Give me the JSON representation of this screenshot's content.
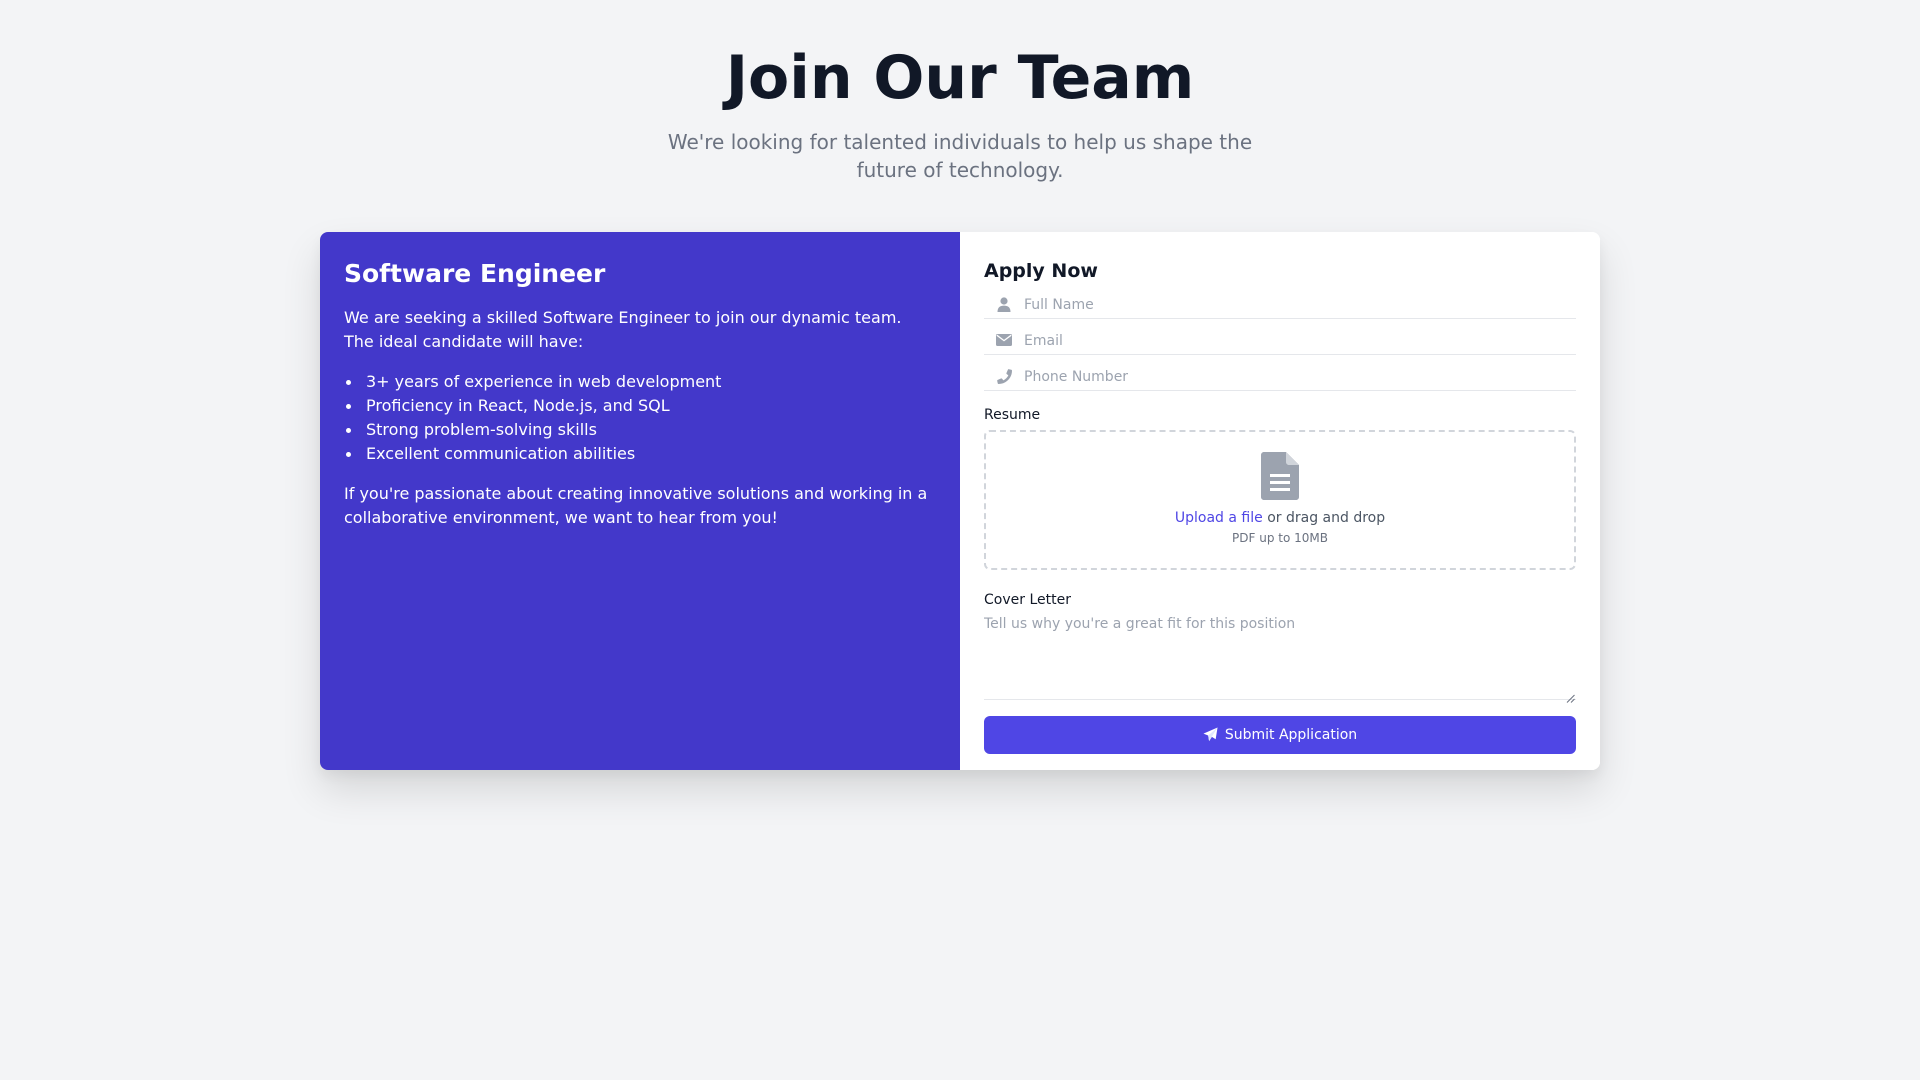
{
  "hero": {
    "title": "Join Our Team",
    "subtitle": "We're looking for talented individuals to help us shape the future of technology."
  },
  "job": {
    "title": "Software Engineer",
    "intro": "We are seeking a skilled Software Engineer to join our dynamic team. The ideal candidate will have:",
    "requirements": [
      "3+ years of experience in web development",
      "Proficiency in React, Node.js, and SQL",
      "Strong problem-solving skills",
      "Excellent communication abilities"
    ],
    "outro": "If you're passionate about creating innovative solutions and working in a collaborative environment, we want to hear from you!"
  },
  "form": {
    "title": "Apply Now",
    "full_name": {
      "icon": "user-icon",
      "placeholder": "Full Name",
      "value": ""
    },
    "email": {
      "icon": "envelope-icon",
      "placeholder": "Email",
      "value": ""
    },
    "phone": {
      "icon": "phone-icon",
      "placeholder": "Phone Number",
      "value": ""
    },
    "resume": {
      "label": "Resume",
      "icon": "file-icon",
      "upload_link": "Upload a file",
      "upload_rest": " or drag and drop",
      "hint": "PDF up to 10MB"
    },
    "cover_letter": {
      "label": "Cover Letter",
      "placeholder": "Tell us why you're a great fit for this position",
      "value": ""
    },
    "submit": {
      "icon": "paper-plane-icon",
      "label": "Submit Application"
    }
  },
  "colors": {
    "page_bg": "#f3f4f6",
    "panel_bg": "#4338ca",
    "accent": "#4f46e5",
    "title": "#111827",
    "muted": "#6b7280"
  }
}
